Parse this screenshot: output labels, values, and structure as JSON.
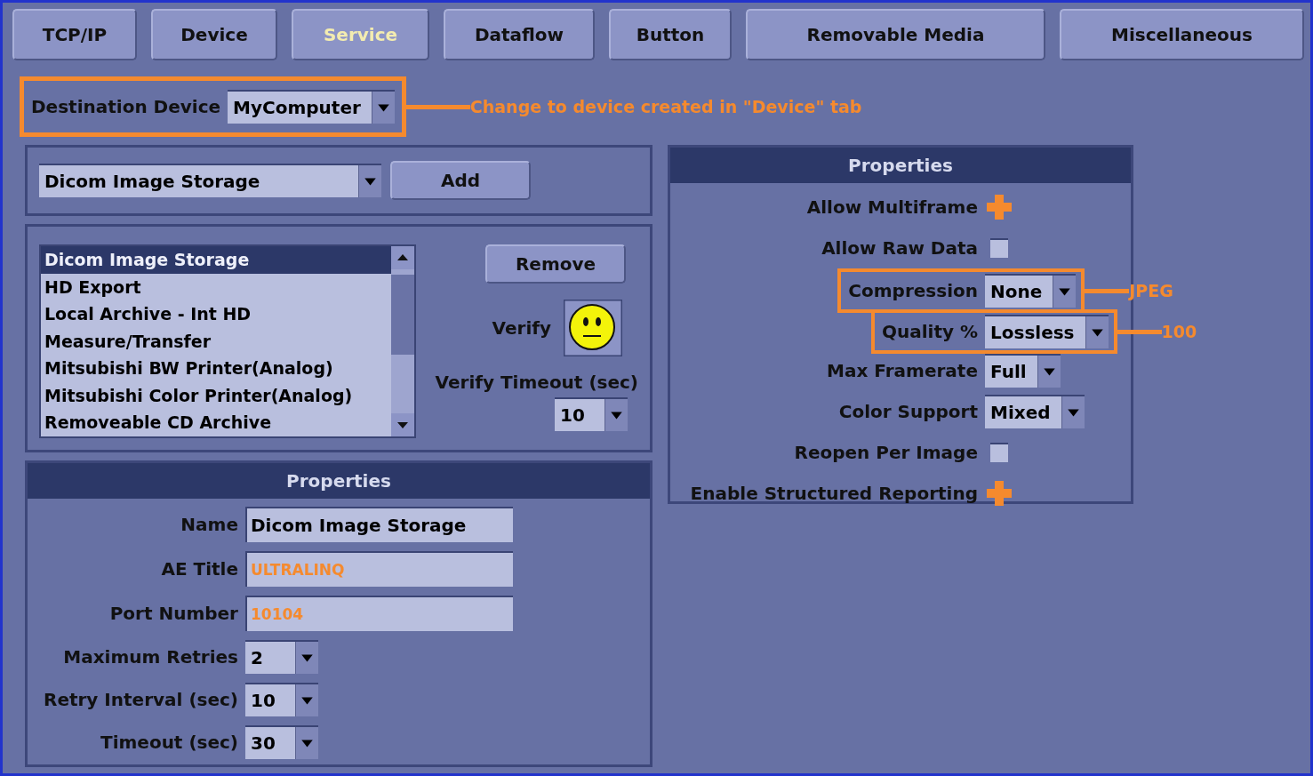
{
  "tabs": [
    {
      "label": "TCP/IP",
      "selected": false
    },
    {
      "label": "Device",
      "selected": false
    },
    {
      "label": "Service",
      "selected": true
    },
    {
      "label": "Dataflow",
      "selected": false
    },
    {
      "label": "Button",
      "selected": false
    },
    {
      "label": "Removable Media",
      "selected": false
    },
    {
      "label": "Miscellaneous",
      "selected": false
    }
  ],
  "destination": {
    "label": "Destination Device",
    "value": "MyComputer",
    "highlighted": true,
    "callout": "Change to device created in \"Device\" tab"
  },
  "service_picker": {
    "value": "Dicom Image Storage",
    "add_button": "Add"
  },
  "services": {
    "items": [
      {
        "label": "Dicom Image Storage",
        "selected": true
      },
      {
        "label": "HD Export",
        "selected": false
      },
      {
        "label": "Local Archive - Int HD",
        "selected": false
      },
      {
        "label": "Measure/Transfer",
        "selected": false
      },
      {
        "label": "Mitsubishi BW Printer(Analog)",
        "selected": false
      },
      {
        "label": "Mitsubishi Color Printer(Analog)",
        "selected": false
      },
      {
        "label": "Removeable CD Archive",
        "selected": false
      }
    ],
    "remove_button": "Remove",
    "verify_label": "Verify",
    "verify_timeout_label": "Verify Timeout (sec)",
    "verify_timeout_value": "10"
  },
  "service_properties": {
    "title": "Properties",
    "fields": [
      {
        "kind": "text",
        "label": "Name",
        "value": "Dicom Image Storage",
        "annotated": false
      },
      {
        "kind": "text",
        "label": "AE Title",
        "value": "ULTRALINQ",
        "annotated": true
      },
      {
        "kind": "text",
        "label": "Port Number",
        "value": "10104",
        "annotated": true
      },
      {
        "kind": "dropdown",
        "label": "Maximum Retries",
        "value": "2"
      },
      {
        "kind": "dropdown",
        "label": "Retry Interval (sec)",
        "value": "10"
      },
      {
        "kind": "dropdown",
        "label": "Timeout (sec)",
        "value": "30"
      }
    ]
  },
  "transfer_properties": {
    "title": "Properties",
    "fields": [
      {
        "kind": "checkbox",
        "label": "Allow Multiframe",
        "checked": true
      },
      {
        "kind": "checkbox",
        "label": "Allow Raw Data",
        "checked": false
      },
      {
        "kind": "dropdown",
        "label": "Compression",
        "value": "None",
        "highlighted": true,
        "callout": "JPEG"
      },
      {
        "kind": "dropdown",
        "label": "Quality %",
        "value": "Lossless",
        "highlighted": true,
        "callout": "100"
      },
      {
        "kind": "dropdown",
        "label": "Max Framerate",
        "value": "Full",
        "highlighted": false
      },
      {
        "kind": "dropdown",
        "label": "Color Support",
        "value": "Mixed",
        "highlighted": false
      },
      {
        "kind": "checkbox",
        "label": "Reopen Per Image",
        "checked": false
      },
      {
        "kind": "checkbox",
        "label": "Enable Structured Reporting",
        "checked": true
      }
    ]
  }
}
